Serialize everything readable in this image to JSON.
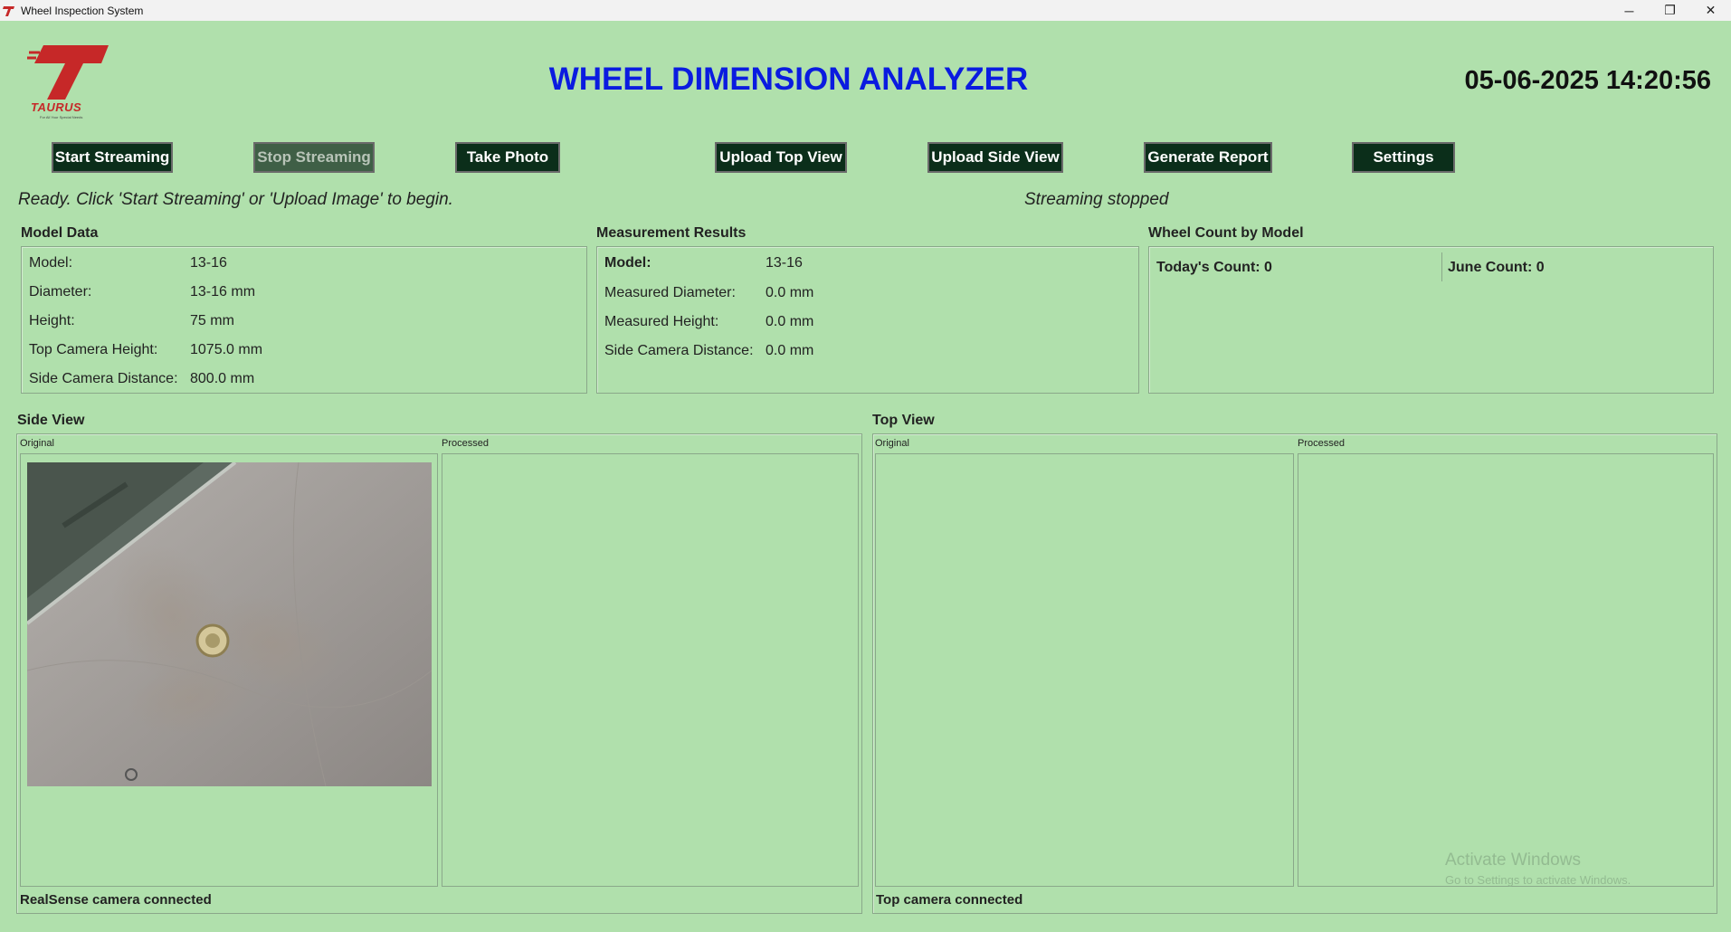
{
  "window": {
    "title": "Wheel Inspection System",
    "controls": {
      "minimize": "─",
      "restore": "❐",
      "close": "✕"
    }
  },
  "header": {
    "logo_text": "TAURUS",
    "logo_tagline": "For All Your Special Needs",
    "title": "WHEEL DIMENSION ANALYZER",
    "datetime": "05-06-2025 14:20:56"
  },
  "toolbar": {
    "start_streaming": "Start Streaming",
    "stop_streaming": "Stop Streaming",
    "take_photo": "Take Photo",
    "upload_top_view": "Upload Top View",
    "upload_side_view": "Upload Side View",
    "generate_report": "Generate Report",
    "settings": "Settings"
  },
  "status": {
    "message": "Ready. Click 'Start Streaming' or 'Upload Image' to begin.",
    "stream_state": "Streaming stopped"
  },
  "model_data": {
    "title": "Model Data",
    "rows": [
      {
        "label": "Model:",
        "value": "13-16"
      },
      {
        "label": "Diameter:",
        "value": "13-16 mm"
      },
      {
        "label": "Height:",
        "value": "75 mm"
      },
      {
        "label": "Top Camera Height:",
        "value": "1075.0 mm"
      },
      {
        "label": "Side Camera Distance:",
        "value": "800.0 mm"
      }
    ]
  },
  "measurement_results": {
    "title": "Measurement Results",
    "rows": [
      {
        "label": "Model:",
        "value": "13-16"
      },
      {
        "label": "Measured Diameter:",
        "value": "0.0 mm"
      },
      {
        "label": "Measured Height:",
        "value": "0.0 mm"
      },
      {
        "label": "Side Camera Distance:",
        "value": "0.0 mm"
      }
    ]
  },
  "wheel_count": {
    "title": "Wheel Count by Model",
    "today": "Today's Count: 0",
    "month": "June Count: 0"
  },
  "side_view": {
    "title": "Side View",
    "original_label": "Original",
    "processed_label": "Processed",
    "camera_status": "RealSense camera connected"
  },
  "top_view": {
    "title": "Top View",
    "original_label": "Original",
    "processed_label": "Processed",
    "camera_status": "Top camera connected"
  },
  "watermark": {
    "line1": "Activate Windows",
    "line2": "Go to Settings to activate Windows."
  },
  "colors": {
    "background": "#b0e0ac",
    "title_blue": "#0a1be0",
    "button_bg": "#0b2e1a",
    "logo_red": "#c62828"
  }
}
